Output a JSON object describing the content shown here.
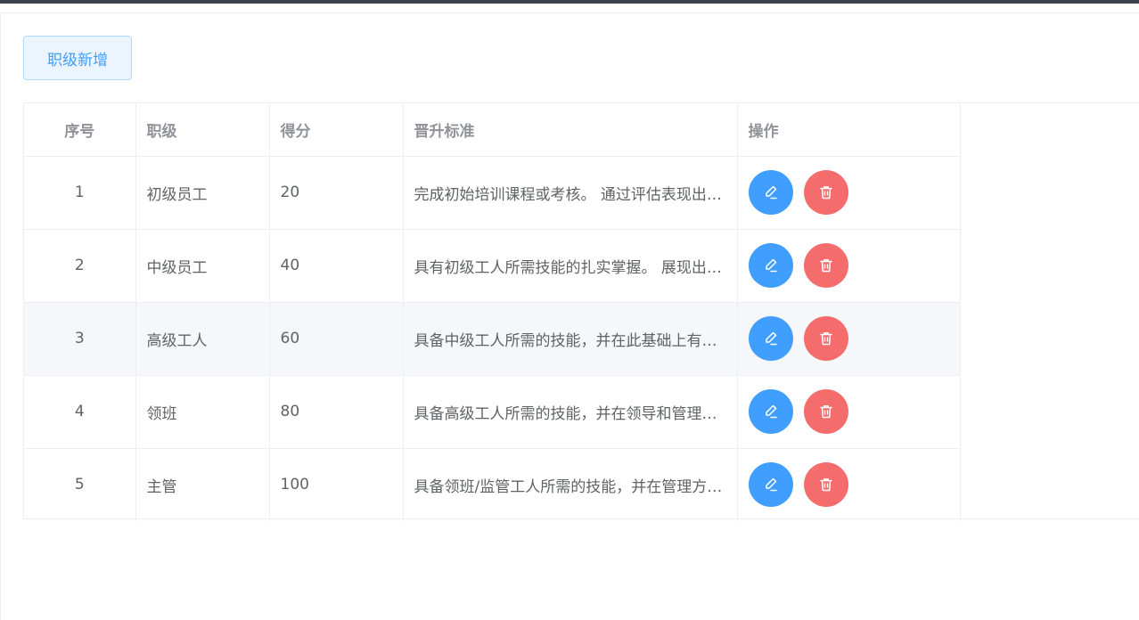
{
  "toolbar": {
    "add_label": "职级新增"
  },
  "table": {
    "headers": {
      "index": "序号",
      "level": "职级",
      "score": "得分",
      "standard": "晋升标准",
      "operations": "操作"
    },
    "rows": [
      {
        "index": "1",
        "level": "初级员工",
        "score": "20",
        "standard": "完成初始培训课程或考核。 通过评估表现出对基本技能的掌握。"
      },
      {
        "index": "2",
        "level": "中级员工",
        "score": "40",
        "standard": "具有初级工人所需技能的扎实掌握。 展现出更高水平的专业能力。"
      },
      {
        "index": "3",
        "level": "高级工人",
        "score": "60",
        "standard": "具备中级工人所需的技能，并在此基础上有所提升。"
      },
      {
        "index": "4",
        "level": "领班",
        "score": "80",
        "standard": "具备高级工人所需的技能，并在领导和管理方面表现突出。"
      },
      {
        "index": "5",
        "level": "主管",
        "score": "100",
        "standard": "具备领班/监管工人所需的技能，并在管理方面经验丰富。"
      }
    ]
  },
  "icons": {
    "edit": "edit-icon",
    "delete": "trash-icon"
  },
  "colors": {
    "primary": "#409eff",
    "danger": "#f56c6c",
    "header_text": "#909399",
    "body_text": "#606266",
    "stripe": "#f5f7fa"
  }
}
